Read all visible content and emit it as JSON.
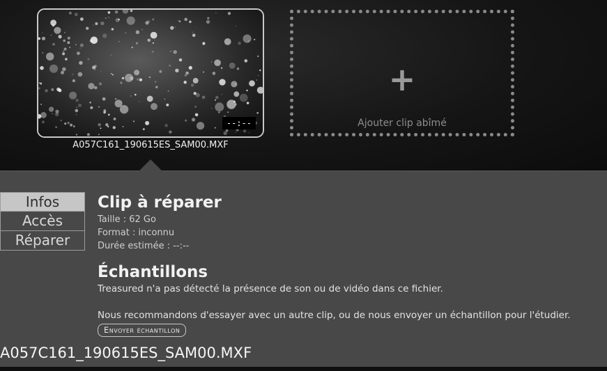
{
  "clips": [
    {
      "name": "A057C161_190615ES_SAM00.MXF",
      "duration": "--:--"
    }
  ],
  "add_slot": {
    "label": "Ajouter clip abîmé",
    "icon": "plus-icon"
  },
  "tabs": [
    {
      "label": "Infos",
      "active": true
    },
    {
      "label": "Accès",
      "active": false
    },
    {
      "label": "Réparer",
      "active": false
    }
  ],
  "info": {
    "title": "Clip à réparer",
    "size": "Taille : 62 Go",
    "format": "Format : inconnu",
    "duration": "Durée estimée : --:--"
  },
  "samples": {
    "title": "Échantillons",
    "message1": "Treasured n'a pas détecté la présence de son ou de vidéo dans ce fichier.",
    "message2": "Nous recommandons d'essayer avec un autre clip, ou de nous envoyer un échantillon pour l'étudier.",
    "send_button": "Envoyer échantillon"
  },
  "footer": {
    "filename": "A057C161_190615ES_SAM00.MXF"
  },
  "colors": {
    "panel": "#484848",
    "active_tab": "#c6c6c6",
    "background": "#141414"
  }
}
